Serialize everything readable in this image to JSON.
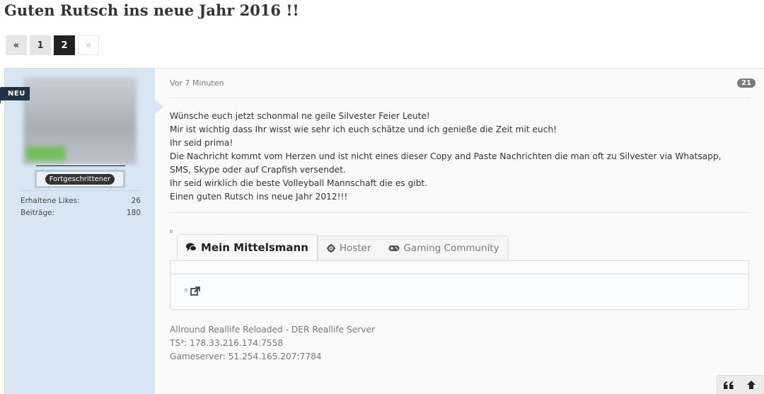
{
  "thread": {
    "title": "Guten Rutsch ins neue Jahr 2016 !!"
  },
  "pagination": {
    "prev": "«",
    "pages": [
      "1",
      "2"
    ],
    "current": "2",
    "next": "»"
  },
  "author": {
    "new_badge": "NEU",
    "rank": "Fortgeschrittener",
    "stats": [
      {
        "label": "Erhaltene Likes:",
        "value": "26"
      },
      {
        "label": "Beiträge:",
        "value": "180"
      }
    ]
  },
  "post": {
    "time": "Vor 7 Minuten",
    "number": "21",
    "message_lines": [
      "Wünsche euch jetzt schonmal ne geile Silvester Feier Leute!",
      "Mir ist wichtig dass Ihr wisst wie sehr ich euch schätze und ich genieße die Zeit mit euch!",
      "Ihr seid prima!",
      "Die Nachricht kommt vom Herzen und ist nicht eines dieser Copy and Paste Nachrichten die man oft zu Silvester via Whatsapp,",
      "SMS, Skype oder auf Crapfish versendet.",
      "Ihr seid wirklich die beste Volleyball Mannschaft die es gibt.",
      "Einen guten Rutsch ins neue Jahr 2012!!!"
    ]
  },
  "tabs": [
    {
      "label": "Mein Mittelsmann",
      "icon": "comments-icon",
      "active": true
    },
    {
      "label": "Hoster",
      "icon": "gear-icon",
      "active": false
    },
    {
      "label": "Gaming Community",
      "icon": "gamepad-icon",
      "active": false
    }
  ],
  "signature_lines": [
    "Allround Reallife Reloaded - DER Reallife Server",
    "TS³: 178.33.216.174:7558",
    "Gameserver: 51.254.165.207:7784"
  ],
  "actions": {
    "quote_icon": "quote-icon",
    "top_icon": "arrow-up-icon"
  },
  "colors": {
    "sidebar": "#d8e6f4",
    "active_page": "#222222",
    "badge": "#243245"
  }
}
